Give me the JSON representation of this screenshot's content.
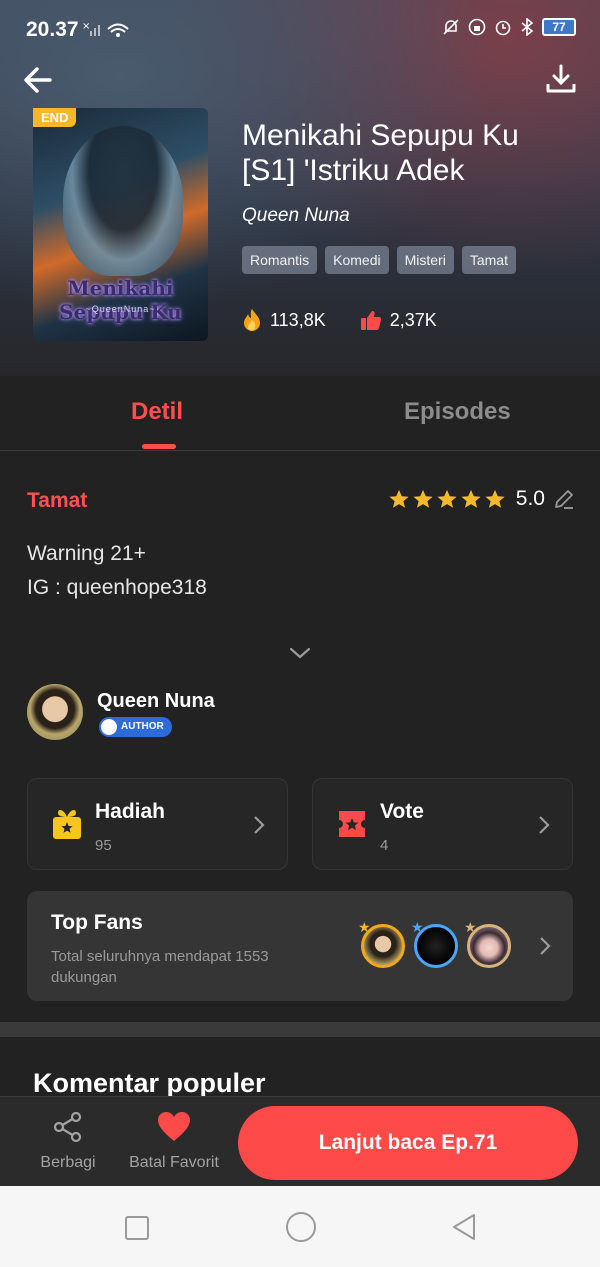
{
  "status_bar": {
    "time": "20.37",
    "battery": "77"
  },
  "book": {
    "badge": "END",
    "title": "Menikahi Sepupu Ku [S1] 'Istriku Adek",
    "author": "Queen Nuna",
    "cover_title": "Menikahi Sepupu Ku",
    "cover_subtitle": "~QueenNuna~",
    "tags": [
      "Romantis",
      "Komedi",
      "Misteri",
      "Tamat"
    ],
    "views": "113,8K",
    "likes": "2,37K"
  },
  "tabs": {
    "detail": "Detil",
    "episodes": "Episodes"
  },
  "detail": {
    "status": "Tamat",
    "rating": "5.0",
    "stars": 5,
    "description": [
      "Warning 21+",
      "IG : queenhope318"
    ],
    "author_name": "Queen Nuna",
    "author_badge": "AUTHOR"
  },
  "cards": {
    "gift": {
      "title": "Hadiah",
      "count": "95"
    },
    "vote": {
      "title": "Vote",
      "count": "4"
    }
  },
  "top_fans": {
    "title": "Top Fans",
    "description": "Total seluruhnya mendapat 1553 dukungan"
  },
  "comments": {
    "title": "Komentar populer"
  },
  "bottom_bar": {
    "share_label": "Berbagi",
    "favorite_label": "Batal Favorit",
    "continue_label": "Lanjut baca Ep.71"
  },
  "colors": {
    "accent": "#ff4a4a",
    "gold": "#f5b82b"
  }
}
